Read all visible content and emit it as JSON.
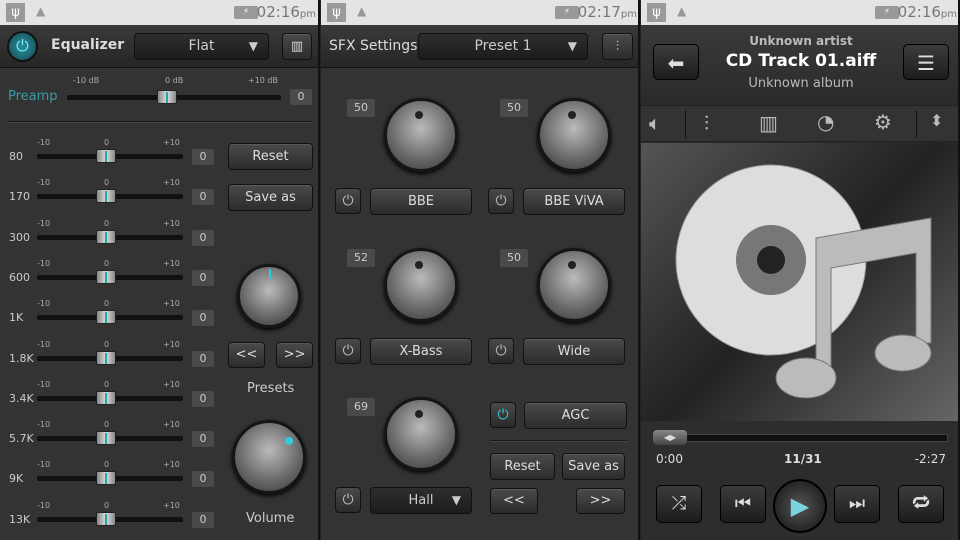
{
  "status": [
    {
      "time": "02:16",
      "ampm": "pm"
    },
    {
      "time": "02:17",
      "ampm": "pm"
    },
    {
      "time": "02:16",
      "ampm": "pm"
    }
  ],
  "eq": {
    "title": "Equalizer",
    "preset": "Flat",
    "preamp_label": "Preamp",
    "preamp_ticks": [
      "-10 dB",
      "0 dB",
      "+10 dB"
    ],
    "preamp_value": "0",
    "band_ticks": [
      "-10",
      "0",
      "+10"
    ],
    "bands": [
      {
        "label": "80",
        "value": "0"
      },
      {
        "label": "170",
        "value": "0"
      },
      {
        "label": "300",
        "value": "0"
      },
      {
        "label": "600",
        "value": "0"
      },
      {
        "label": "1K",
        "value": "0"
      },
      {
        "label": "1.8K",
        "value": "0"
      },
      {
        "label": "3.4K",
        "value": "0"
      },
      {
        "label": "5.7K",
        "value": "0"
      },
      {
        "label": "9K",
        "value": "0"
      },
      {
        "label": "13K",
        "value": "0"
      }
    ],
    "reset": "Reset",
    "save_as": "Save as",
    "prev": "<<",
    "next": ">>",
    "presets_label": "Presets",
    "volume_label": "Volume"
  },
  "sfx": {
    "title": "SFX Settings",
    "preset": "Preset 1",
    "effects": [
      {
        "label": "BBE",
        "value": "50"
      },
      {
        "label": "BBE ViVA",
        "value": "50"
      },
      {
        "label": "X-Bass",
        "value": "52"
      },
      {
        "label": "Wide",
        "value": "50"
      },
      {
        "label": "Hall",
        "value": "69"
      }
    ],
    "agc": "AGC",
    "reset": "Reset",
    "save_as": "Save as",
    "prev": "<<",
    "next": ">>"
  },
  "player": {
    "artist": "Unknown artist",
    "title": "CD Track 01.aiff",
    "album": "Unknown album",
    "elapsed": "0:00",
    "track_pos": "11/31",
    "remaining": "-2:27",
    "progress": 0.0
  }
}
